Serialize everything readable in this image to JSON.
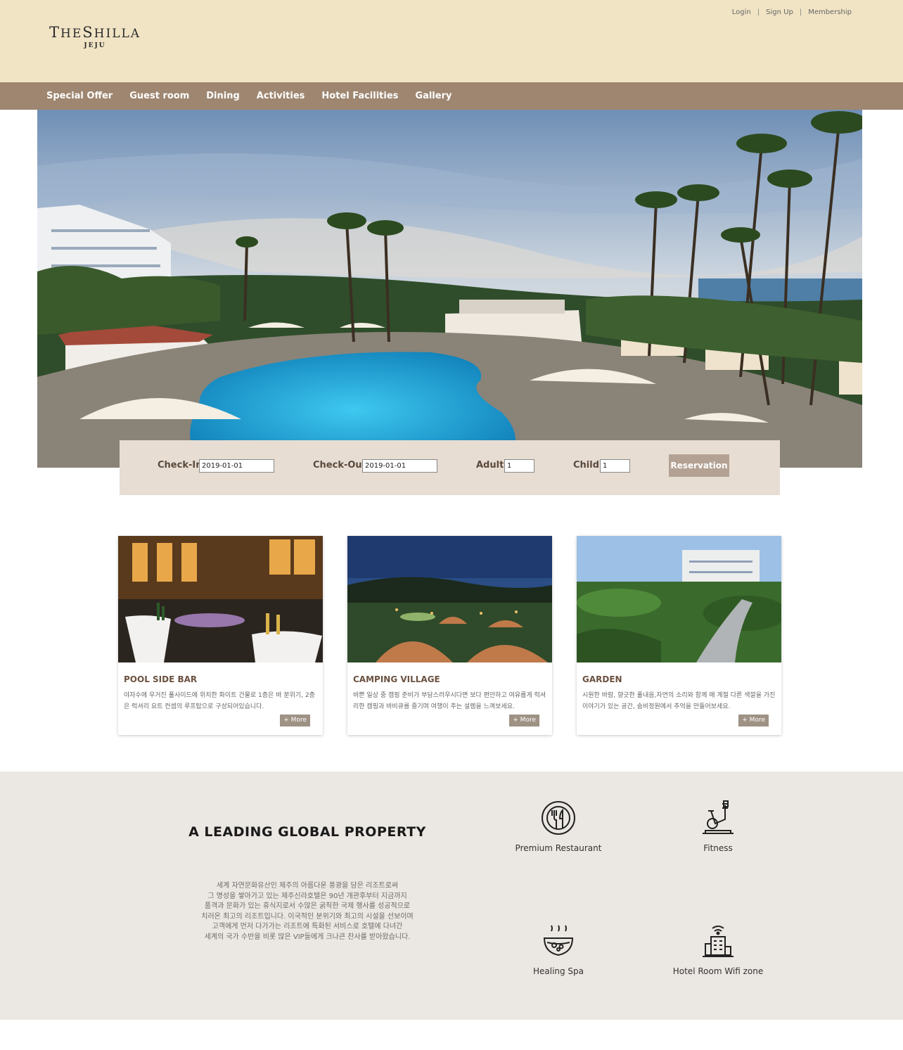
{
  "header": {
    "logo": {
      "main_big": "T",
      "main_rest": "HE",
      "main_big2": "S",
      "main_rest2": "HILLA",
      "sub": "JEJU"
    },
    "util_links": [
      "Login",
      "Sign Up",
      "Membership"
    ]
  },
  "nav": {
    "items": [
      "Special Offer",
      "Guest room",
      "Dining",
      "Activities",
      "Hotel Facilities",
      "Gallery"
    ]
  },
  "booking": {
    "checkin_label": "Check-In",
    "checkin_value": "2019-01-01",
    "checkout_label": "Check-Out",
    "checkout_value": "2019-01-01",
    "adult_label": "Adult",
    "adult_value": "1",
    "child_label": "Child",
    "child_value": "1",
    "button_label": "Reservation"
  },
  "cards": [
    {
      "title": "POOL SIDE BAR",
      "text": "야자수에 우거진 풀사이드에 위치한 화이트 건물로 1층은 바 분위기, 2층은 럭셔리 요트 컨셉의 루프탑으로 구성되어있습니다.",
      "more": "+ More"
    },
    {
      "title": "CAMPING VILLAGE",
      "text": "바쁜 일상 중 캠핑 준비가 부담스러우시다면 보다 편안하고 여유롭게 럭셔리한 캠핑과 바비큐를 즐기며 여행이 주는 설렘을 느껴보세요.",
      "more": "+ More"
    },
    {
      "title": "GARDEN",
      "text": "시원한 바람, 향긋한 풀내음,자연의 소리와 함께 매 계절 다른 색깔을 가진 이야기가 있는 공간, 숨비정원에서 추억을 만들어보세요.",
      "more": "+ More"
    }
  ],
  "property": {
    "title": "A LEADING GLOBAL PROPERTY",
    "lines": [
      "세계 자연문화유산인 제주의 아름다운 풍광을 담은 리조트로써",
      "그 명성을 쌓아가고 있는 제주신라호텔은 90년 개관후부터 지금까지",
      "품격과 문화가 있는 휴식지로서 수많은 굵직한 국제 행사를 성공적으로",
      "치러온 최고의 리조트입니다. 이국적인 분위기와 최고의 시설을 선보이며",
      "고객에게 먼저 다가가는 리조트에 특화된 서비스로 호텔에 다녀간",
      "세계의 국가 수반을 비롯 많은 VIP들에게 크나큰 찬사를 받아왔습니다."
    ],
    "features": [
      {
        "label": "Premium Restaurant",
        "icon": "restaurant-icon"
      },
      {
        "label": "Fitness",
        "icon": "fitness-bike-icon"
      },
      {
        "label": "Healing Spa",
        "icon": "spa-bowl-icon"
      },
      {
        "label": "Hotel Room Wifi zone",
        "icon": "wifi-building-icon"
      }
    ]
  }
}
